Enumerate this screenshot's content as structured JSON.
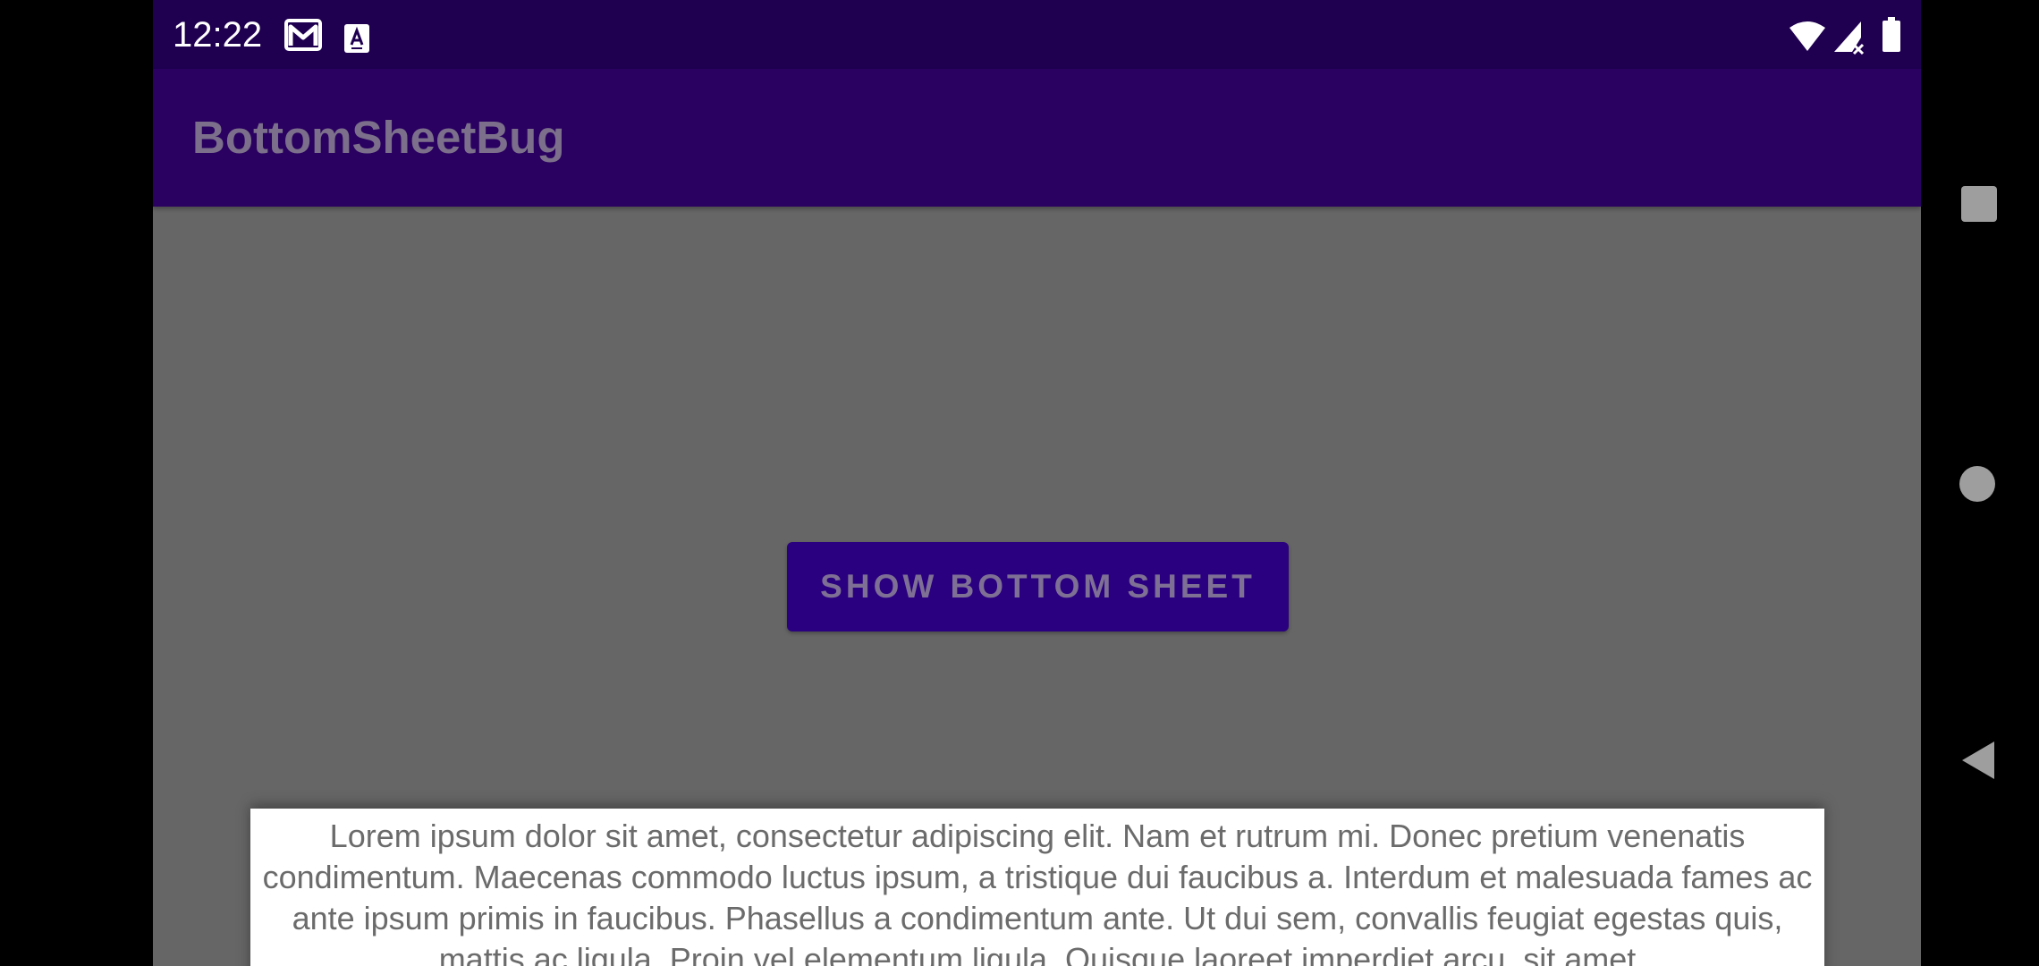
{
  "status_bar": {
    "time": "12:22",
    "icons": [
      "gmail-icon",
      "a-notification-icon",
      "wifi-icon",
      "cell-signal-icon",
      "battery-icon"
    ]
  },
  "app_bar": {
    "title": "BottomSheetBug"
  },
  "main": {
    "button_label": "SHOW BOTTOM SHEET"
  },
  "bottom_sheet": {
    "text": "Lorem ipsum dolor sit amet, consectetur adipiscing elit. Nam et rutrum mi. Donec pretium venenatis condimentum. Maecenas commodo luctus ipsum, a tristique dui faucibus a. Interdum et malesuada fames ac ante ipsum primis in faucibus. Phasellus a condimentum ante. Ut dui sem, convallis feugiat egestas quis, mattis ac ligula. Proin vel elementum ligula. Quisque laoreet imperdiet arcu, sit amet"
  },
  "nav_bar": {
    "buttons": [
      "recents-icon",
      "home-icon",
      "back-icon"
    ]
  },
  "colors": {
    "status_bar": "#1f0050",
    "app_bar": "#2a0060",
    "scrim": "#666666",
    "button": "#2a0080",
    "sheet": "#ffffff"
  }
}
